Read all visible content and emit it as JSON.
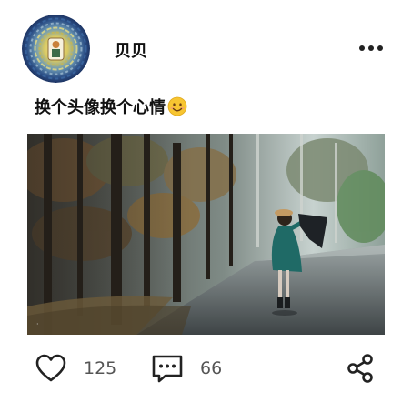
{
  "post": {
    "username": "贝贝",
    "caption": "换个头像换个心情",
    "caption_emoji": "smiling-face-emoji"
  },
  "actions": {
    "like_count": "125",
    "comment_count": "66"
  },
  "icons": {
    "more": "more-dots-icon",
    "like": "heart-icon",
    "comment": "comment-icon",
    "share": "share-icon"
  },
  "colors": {
    "emoji_yellow": "#f7c531",
    "icon_stroke": "#222222",
    "count_text": "#555555"
  }
}
